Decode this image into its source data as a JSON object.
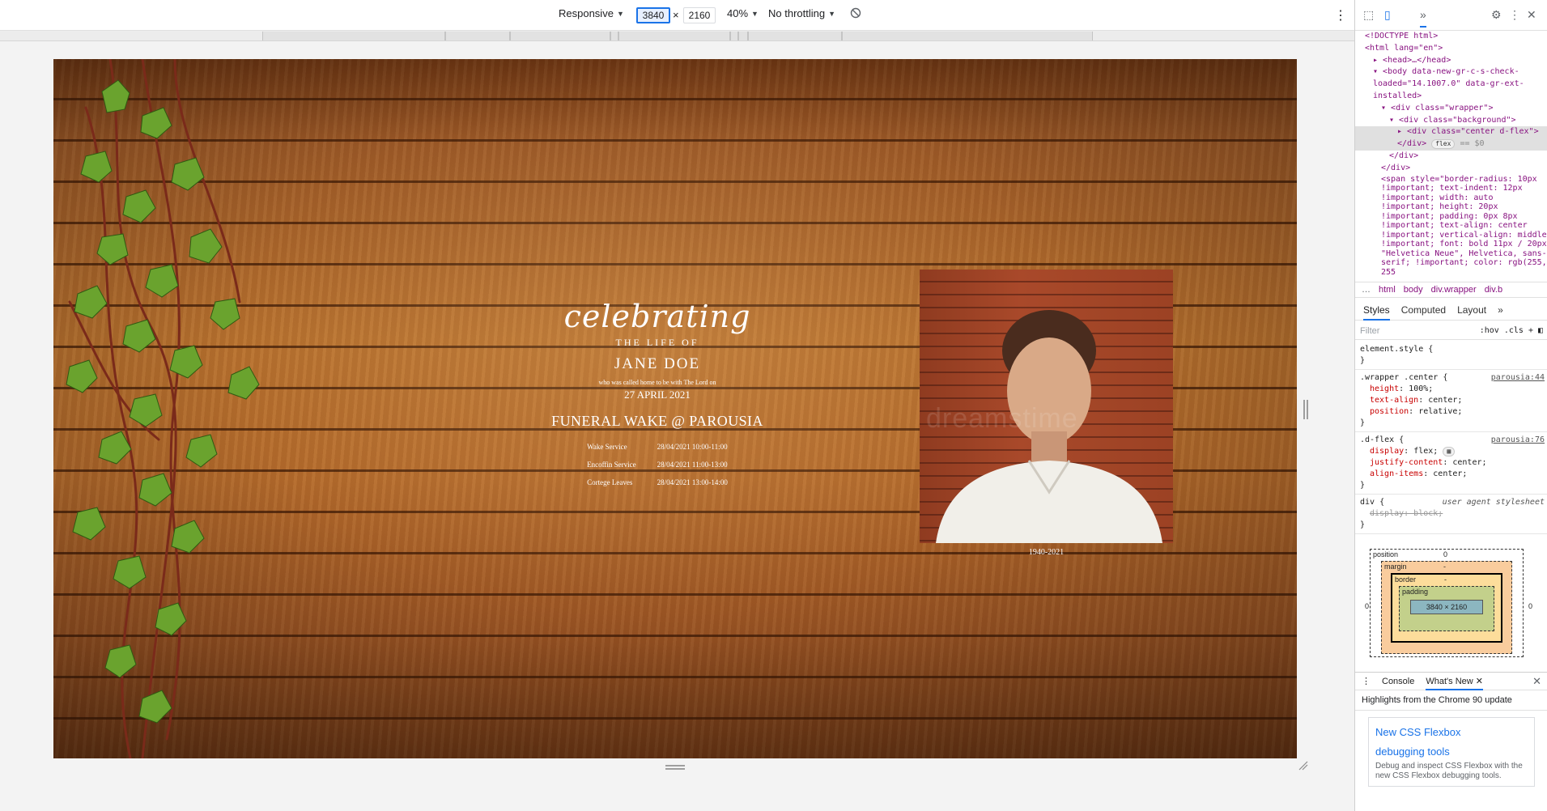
{
  "device_toolbar": {
    "device": "Responsive",
    "width": "3840",
    "separator": "×",
    "height": "2160",
    "zoom": "40%",
    "throttling": "No throttling",
    "rotate_icon": "rotate-icon",
    "more_icon": "more-vertical-icon"
  },
  "page": {
    "celebrating": "celebrating",
    "life_of": "THE LIFE OF",
    "name": "JANE DOE",
    "called_home": "who was called home to be with The Lord on",
    "date_passed": "27 APRIL 2021",
    "wake_title": "FUNERAL WAKE @ PAROUSIA",
    "schedule": [
      {
        "label": "Wake Service",
        "time": "28/04/2021 10:00-11:00"
      },
      {
        "label": "Encoffin Service",
        "time": "28/04/2021 11:00-13:00"
      },
      {
        "label": "Cortege Leaves",
        "time": "28/04/2021 13:00-14:00"
      }
    ],
    "photo_watermark": "dreamstime",
    "years": "1940-2021"
  },
  "devtools": {
    "dom": {
      "doctype": "<!DOCTYPE html>",
      "html_open": "<html lang=\"en\">",
      "head": "<head>…</head>",
      "body_open": "<body data-new-gr-c-s-check-loaded=\"14.1007.0\" data-gr-ext-installed>",
      "wrapper": "<div class=\"wrapper\">",
      "background": "<div class=\"background\">",
      "center": "<div class=\"center d-flex\">",
      "close_div_center": "</div>",
      "flex_pill": "flex",
      "dollar": "== $0",
      "close_div_bg": "</div>",
      "close_div_wrapper": "</div>",
      "span": "<span style=\"border-radius: 10px !important; text-indent: 12px !important; width: auto !important; height: 20px !important; padding: 0px 8px !important; text-align: center !important; vertical-align: middle !important; font: bold 11px / 20px \"Helvetica Neue\", Helvetica, sans-serif; !important; color: rgb(255, 255"
    },
    "breadcrumbs": [
      "html",
      "body",
      "div.wrapper",
      "div.b"
    ],
    "styles_tabs": [
      "Styles",
      "Computed",
      "Layout"
    ],
    "filter_placeholder": "Filter",
    "hov": ":hov",
    "cls": ".cls",
    "rules": {
      "element_style": "element.style {",
      "wrapper_center_selector": ".wrapper .center {",
      "wrapper_center_source": "parousia:44",
      "wrapper_center_props": [
        {
          "name": "height",
          "value": "100%;"
        },
        {
          "name": "text-align",
          "value": "center;"
        },
        {
          "name": "position",
          "value": "relative;"
        }
      ],
      "dflex_selector": ".d-flex {",
      "dflex_source": "parousia:76",
      "dflex_props": [
        {
          "name": "display",
          "value": "flex;"
        },
        {
          "name": "justify-content",
          "value": "center;"
        },
        {
          "name": "align-items",
          "value": "center;"
        }
      ],
      "div_selector": "div {",
      "div_source": "user agent stylesheet",
      "div_struck": "display: block;",
      "close_brace": "}"
    },
    "box_model": {
      "position_label": "position",
      "position_value": "0",
      "margin_label": "margin",
      "border_label": "border",
      "padding_label": "padding",
      "content": "3840 × 2160",
      "dash": "-",
      "zero": "0"
    },
    "drawer": {
      "tabs": [
        "Console",
        "What's New"
      ],
      "highlights": "Highlights from the Chrome 90 update",
      "feature_title_1": "New CSS Flexbox",
      "feature_title_2": "debugging tools",
      "feature_desc": "Debug and inspect CSS Flexbox with the new CSS Flexbox debugging tools."
    }
  }
}
